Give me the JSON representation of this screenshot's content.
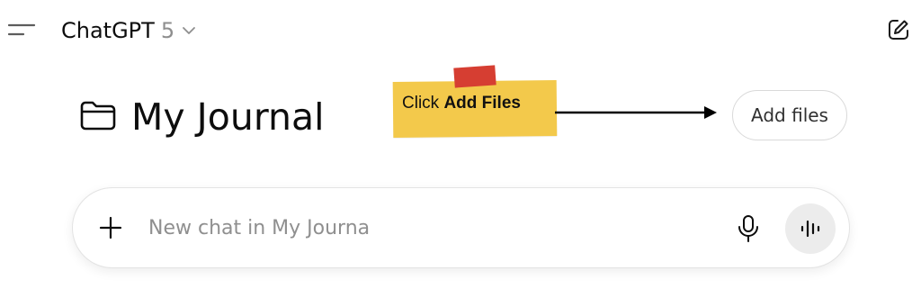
{
  "header": {
    "app_name": "ChatGPT",
    "model_version": "5",
    "icons": {
      "menu": "menu-icon",
      "model_dropdown": "chevron-down-icon",
      "new_chat": "compose-icon"
    }
  },
  "project": {
    "title": "My Journal",
    "icon": "folder-icon",
    "add_files_label": "Add files"
  },
  "annotation": {
    "text_prefix": "Click",
    "text_bold": "Add Files",
    "note_color": "#f3c94b",
    "tape_color": "#d63e32"
  },
  "composer": {
    "placeholder": "New chat in My Journa",
    "value": "",
    "icons": {
      "attach": "plus-icon",
      "dictate": "microphone-icon",
      "voice_mode": "voice-waveform-icon"
    }
  }
}
